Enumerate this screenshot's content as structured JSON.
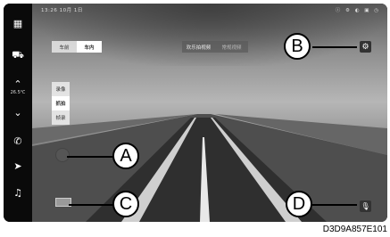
{
  "status": {
    "time": "13:26",
    "date": "10月 1日",
    "right_icons": "ⓘ ⚙ ◐ ▣ ◷"
  },
  "sidebar": {
    "items": [
      {
        "icon": "grid-icon",
        "glyph": "▦"
      },
      {
        "icon": "car-icon",
        "glyph": "🚗"
      },
      {
        "icon": "chevron-up-icon",
        "glyph": "︿"
      },
      {
        "icon": "chevron-down-icon",
        "glyph": "﹀"
      },
      {
        "icon": "phone-icon",
        "glyph": "✆"
      },
      {
        "icon": "navigation-icon",
        "glyph": "➤"
      },
      {
        "icon": "music-icon",
        "glyph": "♫"
      }
    ],
    "temperature": "26.5℃"
  },
  "camera_tabs": {
    "left": "车前",
    "right": "车内"
  },
  "media_tabs": {
    "left": "欢乐拍视频",
    "right": "常规视频"
  },
  "mode_list": [
    "录像",
    "抓拍",
    "帧录"
  ],
  "callouts": {
    "a": "A",
    "b": "B",
    "c": "C",
    "d": "D"
  },
  "figure_code": "D3D9A857E101"
}
